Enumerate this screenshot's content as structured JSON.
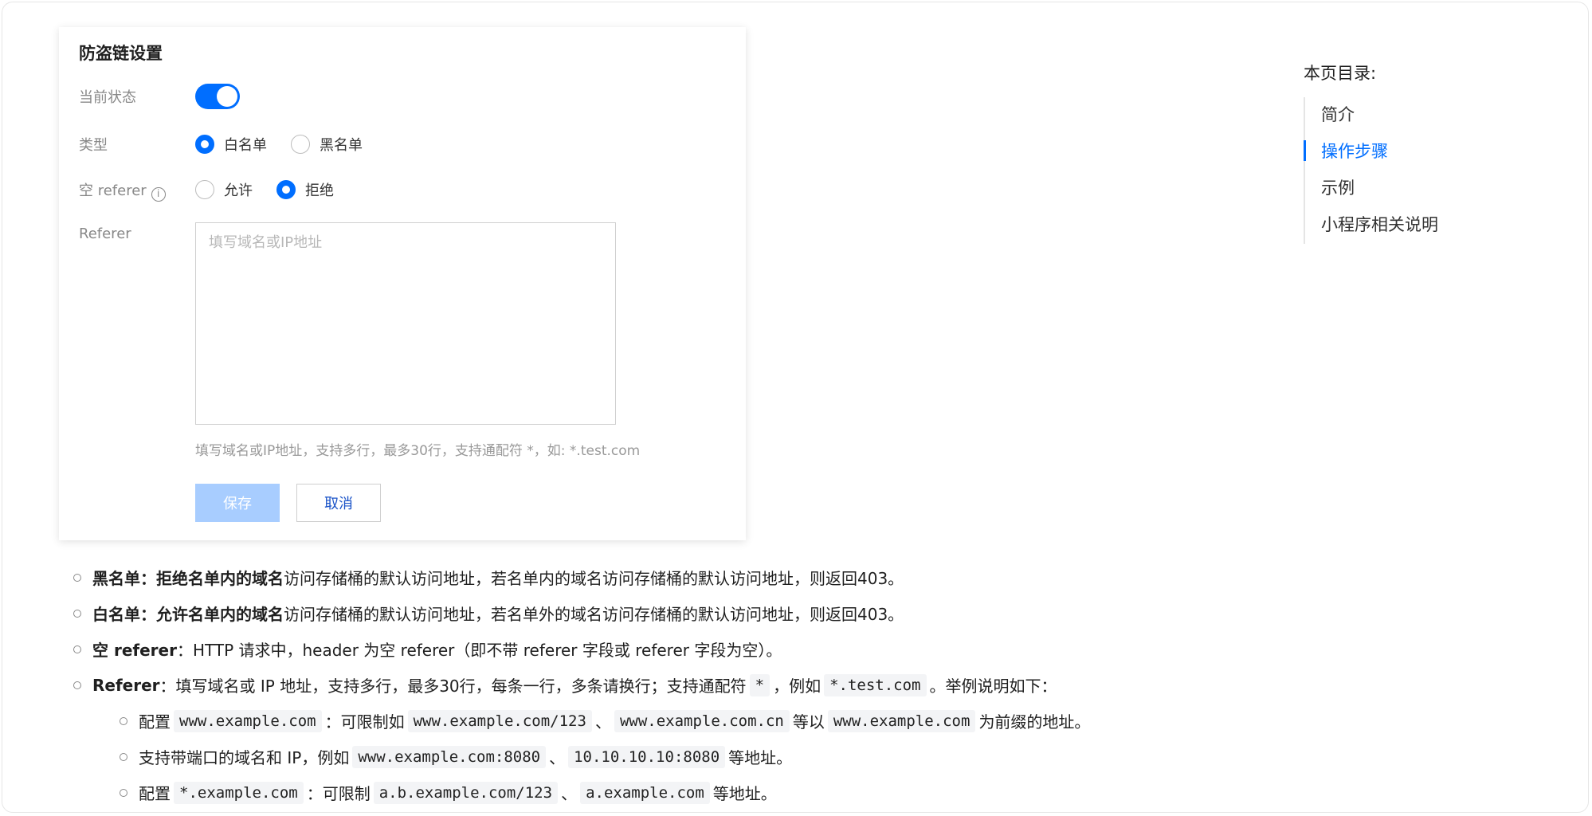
{
  "panel": {
    "title": "防盗链设置",
    "status_label": "当前状态",
    "status_on": true,
    "type_label": "类型",
    "type_options": [
      "白名单",
      "黑名单"
    ],
    "type_selected": "白名单",
    "empty_referer_label": "空 referer",
    "empty_referer_options": [
      "允许",
      "拒绝"
    ],
    "empty_referer_selected": "拒绝",
    "referer_label": "Referer",
    "referer_placeholder": "填写域名或IP地址",
    "referer_hint": "填写域名或IP地址，支持多行，最多30行，支持通配符 *，如: *.test.com",
    "save_label": "保存",
    "cancel_label": "取消"
  },
  "toc": {
    "title": "本页目录:",
    "items": [
      "简介",
      "操作步骤",
      "示例",
      "小程序相关说明"
    ],
    "active": "操作步骤"
  },
  "content": {
    "item1": {
      "term": "黑名单",
      "sep": "：",
      "strong": "拒绝名单内的域名",
      "text": "访问存储桶的默认访问地址，若名单内的域名访问存储桶的默认访问地址，则返回403。"
    },
    "item2": {
      "term": "白名单",
      "sep": "：",
      "strong": "允许名单内的域名",
      "text": "访问存储桶的默认访问地址，若名单外的域名访问存储桶的默认访问地址，则返回403。"
    },
    "item3": {
      "term": "空 referer",
      "text": "：HTTP 请求中，header 为空 referer（即不带 referer 字段或 referer 字段为空）。"
    },
    "item4": {
      "term": "Referer",
      "text1": "：填写域名或 IP 地址，支持多行，最多30行，每条一行，多条请换行；支持通配符",
      "code1": "*",
      "text2": "，例如",
      "code2": "*.test.com",
      "text3": "。举例说明如下："
    },
    "sub1": {
      "t1": "配置",
      "c1": "www.example.com",
      "t2": "：可限制如",
      "c2": "www.example.com/123",
      "t3": "、",
      "c3": "www.example.com.cn",
      "t4": "等以",
      "c4": "www.example.com",
      "t5": "为前缀的地址。"
    },
    "sub2": {
      "t1": "支持带端口的域名和 IP，例如",
      "c1": "www.example.com:8080",
      "t2": "、",
      "c2": "10.10.10.10:8080",
      "t3": "等地址。"
    },
    "sub3": {
      "t1": "配置",
      "c1": "*.example.com",
      "t2": "：可限制",
      "c2": "a.b.example.com/123",
      "t3": "、",
      "c3": "a.example.com",
      "t4": "等地址。"
    }
  }
}
